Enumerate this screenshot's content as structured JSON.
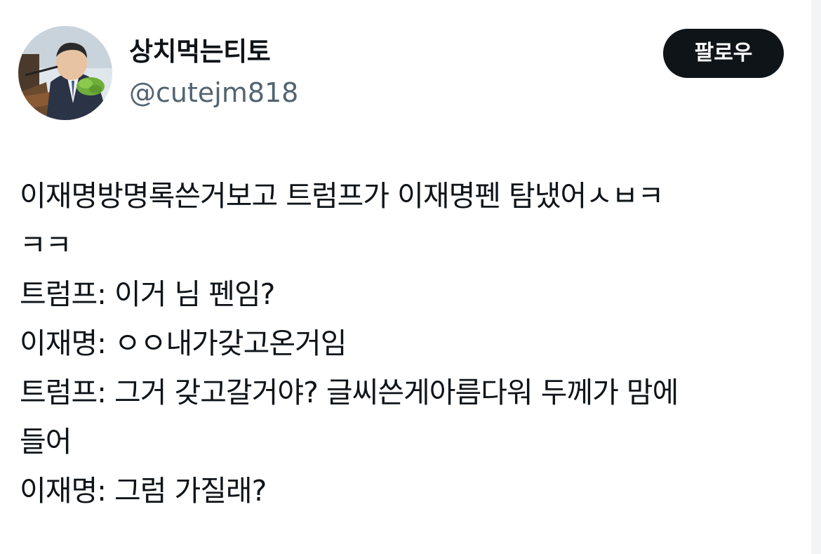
{
  "author": {
    "display_name": "상치먹는티토",
    "handle": "@cutejm818",
    "avatar": "profile-photo"
  },
  "follow_button": {
    "label": "팔로우"
  },
  "tweet": {
    "lines": [
      "이재명방명록쓴거보고 트럼프가 이재명펜 탐냈어ㅅㅂㅋ",
      "ㅋㅋ",
      "트럼프: 이거 님 펜임?",
      "이재명: ㅇㅇ내가갖고온거임",
      "트럼프: 그거 갖고갈거야? 글씨쓴게아름다워 두께가 맘에",
      "들어",
      "이재명: 그럼 가질래?"
    ]
  },
  "colors": {
    "text_primary": "#0f1419",
    "text_secondary": "#536471",
    "button_bg": "#0f1419",
    "button_text": "#ffffff",
    "background": "#ffffff"
  }
}
